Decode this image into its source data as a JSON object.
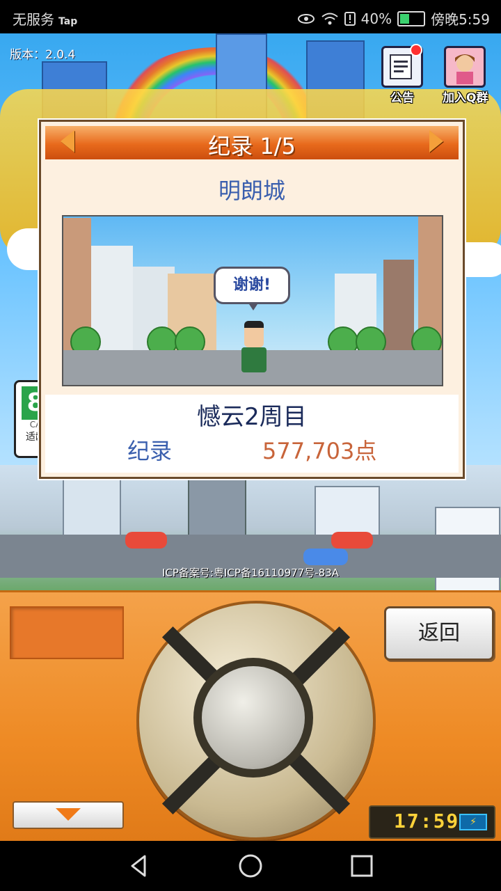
{
  "status_bar": {
    "carrier": "无服务",
    "app_tag": "Tap",
    "battery_percent": "40%",
    "time": "傍晚5:59",
    "icons": [
      "eye-icon",
      "wifi-icon",
      "alert-icon",
      "battery-icon"
    ]
  },
  "scene": {
    "version_text": "版本：2.0.4",
    "announcement_label": "公告",
    "join_group_label": "加入Q群",
    "rating_number": "8",
    "rating_sub": "CA",
    "rating_label": "适龄",
    "icp_text": "ICP备案号:粤ICP备16110977号-83A"
  },
  "dialog": {
    "title": "纪录 1/5",
    "city_name": "明朗城",
    "speech_text": "谢谢!",
    "save_name": "憾云2周目",
    "record_label": "纪录",
    "record_value": "577,703点"
  },
  "panel": {
    "back_label": "返回",
    "clock": "17:59",
    "battery_icon": "⚡"
  },
  "colors": {
    "header_orange": "#e86a1c",
    "panel_orange": "#ee8a24",
    "title_blue": "#3a5fae",
    "value_orange": "#c8643a"
  },
  "navbar": {
    "icons": [
      "back-triangle-icon",
      "home-circle-icon",
      "recents-square-icon"
    ]
  }
}
